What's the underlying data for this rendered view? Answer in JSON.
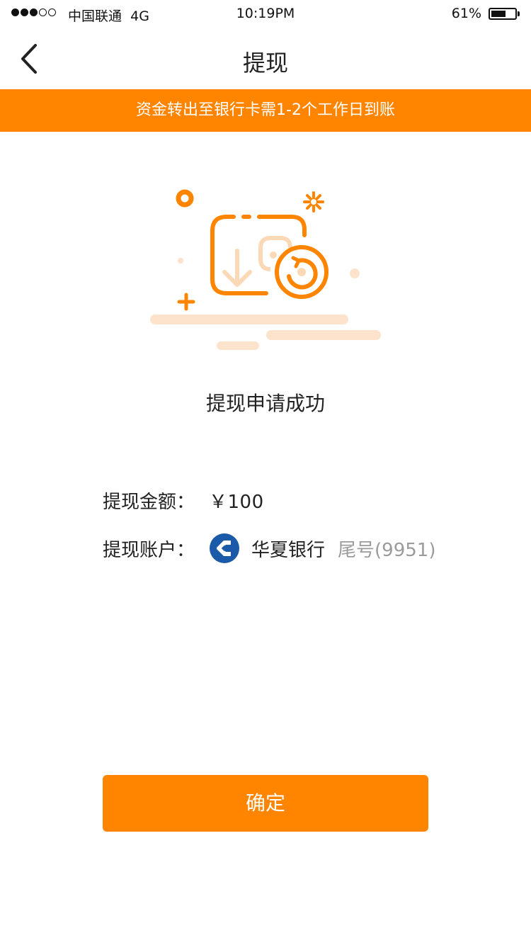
{
  "status_bar": {
    "carrier": "中国联通",
    "network": "4G",
    "time": "10:19PM",
    "battery": "61%",
    "battery_level": 0.61,
    "signal_strength": 3,
    "signal_max": 5
  },
  "nav": {
    "title": "提现",
    "back_icon": "chevron-left-icon"
  },
  "notice": {
    "text": "资金转出至银行卡需1-2个工作日到账"
  },
  "illustration": {
    "icon": "withdraw-wallet-illustration"
  },
  "result": {
    "message": "提现申请成功"
  },
  "details": {
    "amount_label": "提现金额：",
    "amount_value": "￥100",
    "account_label": "提现账户：",
    "bank_icon": "huaxia-bank-logo-icon",
    "bank_name": "华夏银行",
    "card_tail": "尾号(9951)"
  },
  "confirm": {
    "label": "确定"
  },
  "colors": {
    "accent": "#ff8400",
    "accent_light": "#fde3cb",
    "bank_blue": "#1a5aa8",
    "muted_text": "#9b9b9b"
  }
}
